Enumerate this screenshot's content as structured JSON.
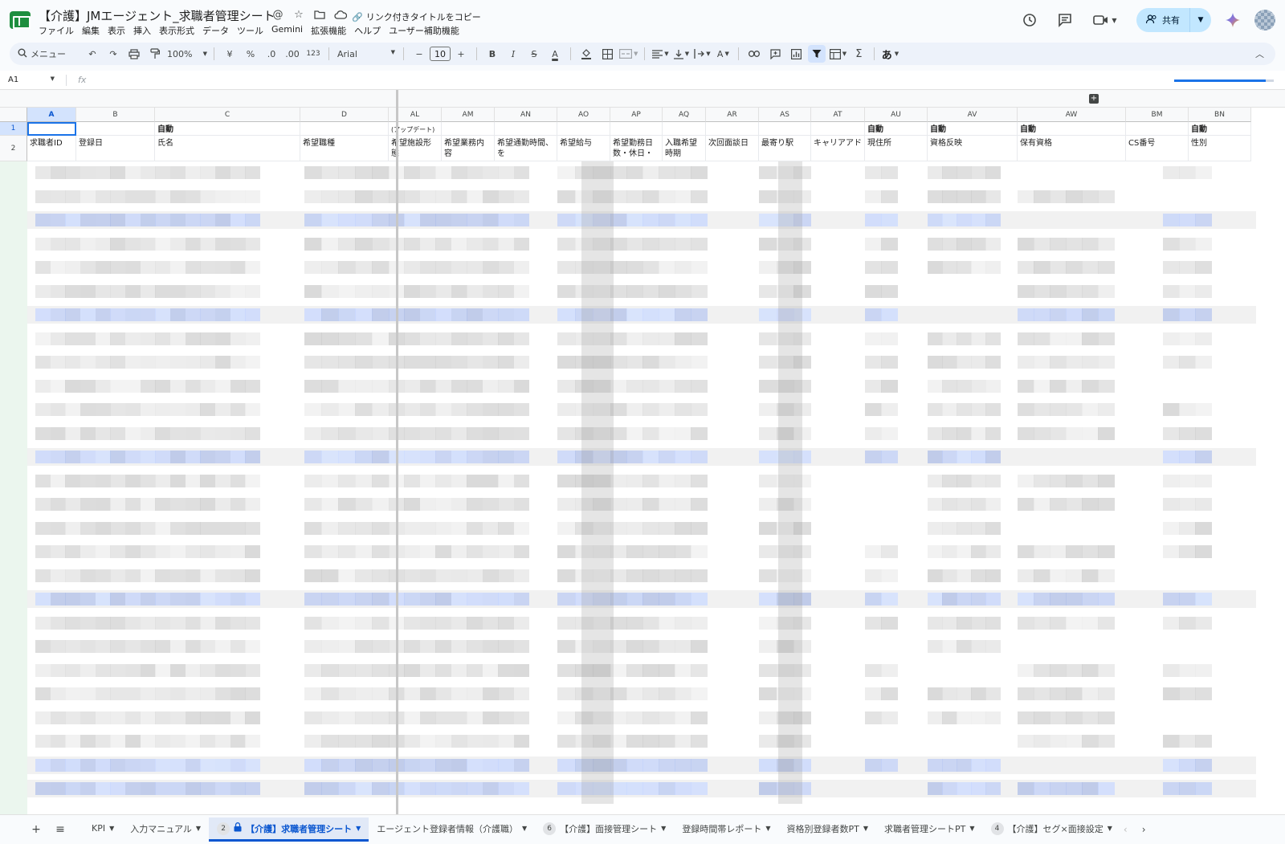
{
  "title_bar": {
    "doc_title": "【介護】JMエージェント_求職者管理シート",
    "copy_link_label": "リンク付きタイトルをコピー",
    "share_label": "共有"
  },
  "menu": [
    "ファイル",
    "編集",
    "表示",
    "挿入",
    "表示形式",
    "データ",
    "ツール",
    "Gemini",
    "拡張機能",
    "ヘルプ",
    "ユーザー補助機能"
  ],
  "toolbar": {
    "search_placeholder": "メニュー",
    "zoom": "100%",
    "currency": "¥",
    "percent": "%",
    "dec_decrease": ".0",
    "dec_increase": ".00",
    "number_format": "123",
    "font": "Arial",
    "font_size": "10",
    "bold": "B",
    "italic": "I",
    "strike": "S",
    "text_color": "A",
    "function_symbol": "Σ",
    "input_tool": "あ"
  },
  "formula_bar": {
    "cell_ref": "A1",
    "fx": "fx",
    "loading_progress": 0.92
  },
  "grid": {
    "columns": [
      "A",
      "B",
      "C",
      "D",
      "AL",
      "AM",
      "AN",
      "AO",
      "AP",
      "AQ",
      "AR",
      "AS",
      "AT",
      "AU",
      "AV",
      "AW",
      "BM",
      "BN"
    ],
    "selected_column": "A",
    "rows": [
      "1",
      "2"
    ],
    "row1": {
      "C": "自動",
      "AL": "(アップデート)",
      "AU": "自動",
      "AV": "自動",
      "AW": "自動",
      "BN": "自動"
    },
    "row2": {
      "A": "求職者ID",
      "B": "登録日",
      "C": "氏名",
      "D": "希望職種",
      "AL": "希望施設形態",
      "AM": "希望業務内容",
      "AN": "希望通勤時間、を",
      "AO": "希望給与",
      "AP": "希望勤務日数・休日・",
      "AQ": "入職希望時期",
      "AR": "次回面談日",
      "AS": "最寄り駅",
      "AT": "キャリアアド",
      "AU": "現住所",
      "AV": "資格反映",
      "AW": "保有資格",
      "BM": "CS番号",
      "BN": "性別"
    },
    "colors": {
      "selection": "#d3e3fd",
      "accent": "#1a73e8",
      "blurred_highlight": "#c9d6f5",
      "blurred_gray": "#d6d6d6"
    }
  },
  "sheet_tabs": [
    {
      "label": "KPI",
      "badge": ""
    },
    {
      "label": "入力マニュアル",
      "badge": ""
    },
    {
      "label": "【介護】求職者管理シート",
      "badge": "2",
      "active": true,
      "locked": true
    },
    {
      "label": "エージェント登録者情報（介護職）",
      "badge": ""
    },
    {
      "label": "【介護】面接管理シート",
      "badge": "6"
    },
    {
      "label": "登録時間帯レポート",
      "badge": ""
    },
    {
      "label": "資格別登録者数PT",
      "badge": ""
    },
    {
      "label": "求職者管理シートPT",
      "badge": ""
    },
    {
      "label": "【介護】セグ×面接設定",
      "badge": "4"
    }
  ],
  "icons": {
    "history": "history-icon",
    "comments": "comment-icon",
    "meet": "video-icon",
    "share": "person-add-icon",
    "gemini": "gemini-star-icon"
  }
}
